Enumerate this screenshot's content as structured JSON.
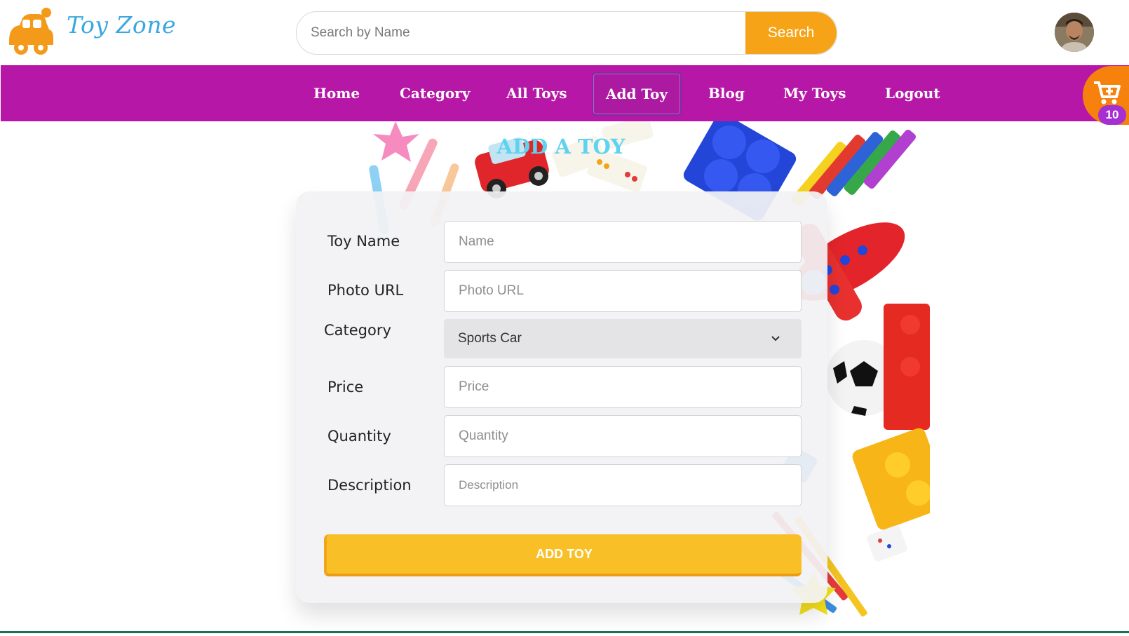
{
  "brand": {
    "name": "Toy Zone",
    "logo_icon": "car-logo-icon"
  },
  "search": {
    "placeholder": "Search by Name",
    "button_label": "Search"
  },
  "nav": {
    "items": [
      {
        "label": "Home"
      },
      {
        "label": "Category"
      },
      {
        "label": "All Toys"
      },
      {
        "label": "Add Toy",
        "active": true
      },
      {
        "label": "Blog"
      },
      {
        "label": "My Toys"
      },
      {
        "label": "Logout"
      }
    ]
  },
  "cart": {
    "icon": "cart-plus-icon",
    "count": "10"
  },
  "page": {
    "title": "ADD A TOY"
  },
  "form": {
    "toy_name": {
      "label": "Toy Name",
      "placeholder": "Name"
    },
    "photo_url": {
      "label": "Photo URL",
      "placeholder": "Photo URL"
    },
    "category": {
      "label": "Category",
      "value": "Sports Car"
    },
    "price": {
      "label": "Price",
      "placeholder": "Price"
    },
    "quantity": {
      "label": "Quantity",
      "placeholder": "Quantity"
    },
    "description": {
      "label": "Description",
      "placeholder": "Description"
    },
    "submit_label": "ADD TOY"
  },
  "colors": {
    "nav_bg": "#b617a6",
    "accent_orange": "#f6a317",
    "button_yellow": "#f8c026",
    "title_cyan": "#5ed3f0"
  }
}
